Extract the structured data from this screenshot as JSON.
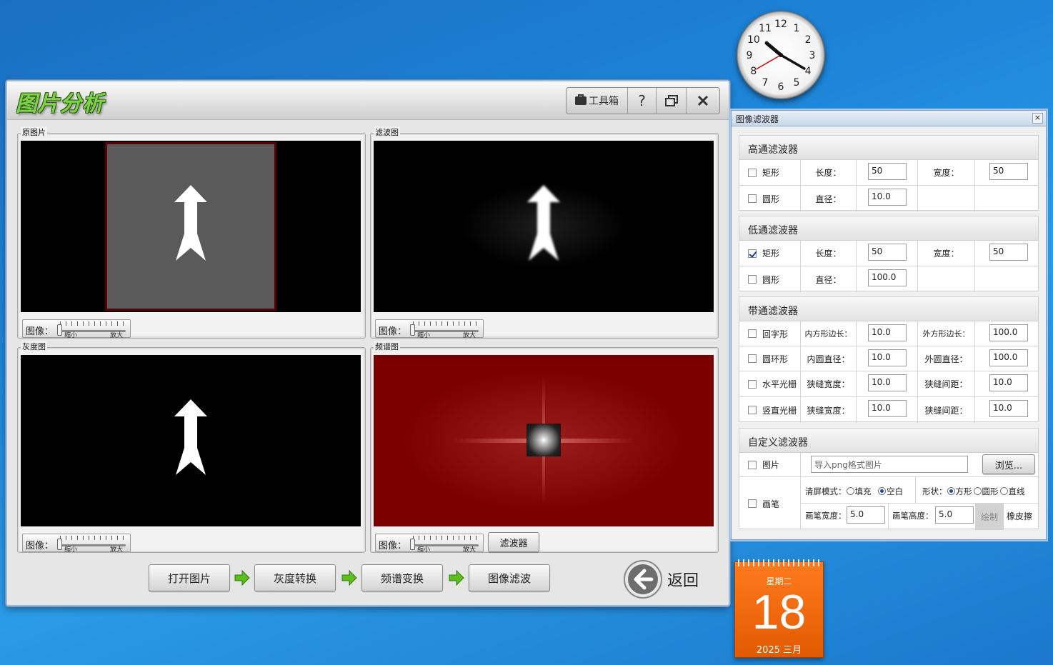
{
  "app": {
    "title": "图片分析"
  },
  "toolbar": {
    "toolbox_label": "工具箱",
    "help_label": "?"
  },
  "panels": {
    "original": {
      "label": "原图片"
    },
    "filtered": {
      "label": "滤波图"
    },
    "gray": {
      "label": "灰度图"
    },
    "spectrum": {
      "label": "频谱图"
    }
  },
  "zoom": {
    "label": "图像：",
    "min": "缩小",
    "max": "放大"
  },
  "filter_button": "滤波器",
  "workflow": {
    "open": "打开图片",
    "gray": "灰度转换",
    "spectrum": "频谱变换",
    "filter": "图像滤波",
    "back": "返回"
  },
  "filter_window": {
    "title": "图像滤波器",
    "close": "×",
    "high_pass": {
      "title": "高通滤波器",
      "rect": {
        "label": "矩形",
        "checked": false,
        "length_label": "长度：",
        "length": "50",
        "width_label": "宽度：",
        "width": "50"
      },
      "circle": {
        "label": "圆形",
        "checked": false,
        "diameter_label": "直径：",
        "diameter": "10.0"
      }
    },
    "low_pass": {
      "title": "低通滤波器",
      "rect": {
        "label": "矩形",
        "checked": true,
        "length_label": "长度：",
        "length": "50",
        "width_label": "宽度：",
        "width": "50"
      },
      "circle": {
        "label": "圆形",
        "checked": false,
        "diameter_label": "直径：",
        "diameter": "100.0"
      }
    },
    "band_pass": {
      "title": "带通滤波器",
      "square_ring": {
        "label": "回字形",
        "inner_label": "内方形边长：",
        "inner": "10.0",
        "outer_label": "外方形边长：",
        "outer": "100.0"
      },
      "annulus": {
        "label": "圆环形",
        "inner_label": "内圆直径：",
        "inner": "10.0",
        "outer_label": "外圆直径：",
        "outer": "100.0"
      },
      "h_grating": {
        "label": "水平光栅",
        "slit_width_label": "狭缝宽度：",
        "slit_width": "10.0",
        "slit_gap_label": "狭缝间距：",
        "slit_gap": "10.0"
      },
      "v_grating": {
        "label": "竖直光栅",
        "slit_width_label": "狭缝宽度：",
        "slit_width": "10.0",
        "slit_gap_label": "狭缝间距：",
        "slit_gap": "10.0"
      }
    },
    "custom": {
      "title": "自定义滤波器",
      "image": {
        "label": "图片",
        "placeholder": "导入png格式图片",
        "browse": "浏览..."
      },
      "brush": {
        "label": "画笔",
        "clear_mode_label": "清屏模式：",
        "fill": "填充",
        "blank": "空白",
        "clear_mode": "空白",
        "shape_label": "形状：",
        "square": "方形",
        "round": "圆形",
        "line": "直线",
        "shape": "方形",
        "brush_width_label": "画笔宽度：",
        "brush_width": "5.0",
        "brush_height_label": "画笔高度：",
        "brush_height": "5.0",
        "draw": "绘制",
        "eraser": "橡皮擦"
      }
    }
  },
  "calendar": {
    "weekday": "星期二",
    "day": "18",
    "month_year": "2025 三月"
  },
  "clock": {
    "numerals": [
      "12",
      "1",
      "2",
      "3",
      "4",
      "5",
      "6",
      "7",
      "8",
      "9",
      "10",
      "11"
    ],
    "hour": 10,
    "minute": 20,
    "second": 40
  },
  "colors": {
    "accent_green": "#7fd14a",
    "spectrum_bg": "#7a0000",
    "calendar_orange": "#f26a0a"
  }
}
